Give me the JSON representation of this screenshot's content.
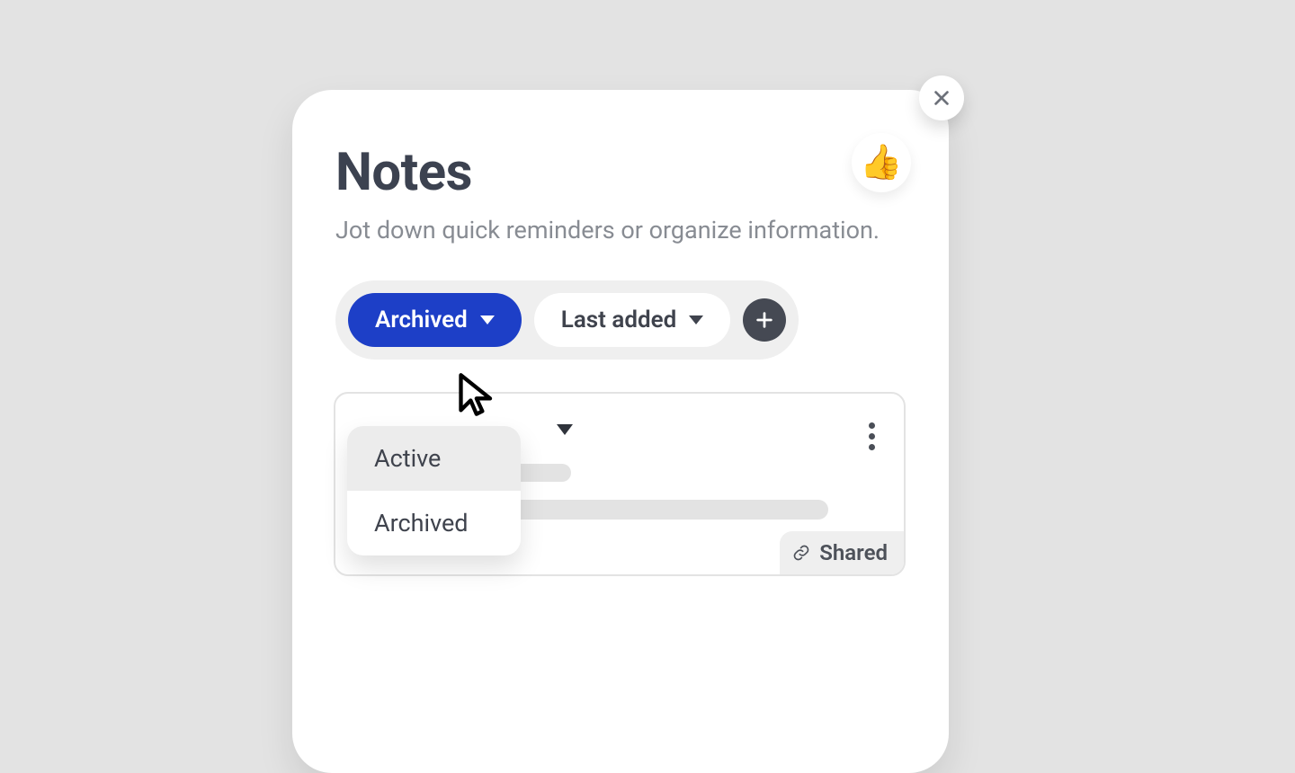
{
  "header": {
    "title": "Notes",
    "subtitle": "Jot down quick reminders or organize information.",
    "thumbs_emoji": "👍"
  },
  "toolbar": {
    "filter": {
      "selected": "Archived",
      "options": [
        "Active",
        "Archived"
      ]
    },
    "sort": {
      "selected": "Last added"
    }
  },
  "note": {
    "shared_label": "Shared"
  },
  "colors": {
    "accent": "#1d3fc7",
    "text": "#3c4250",
    "muted": "#888c93",
    "surface": "#efefef"
  }
}
